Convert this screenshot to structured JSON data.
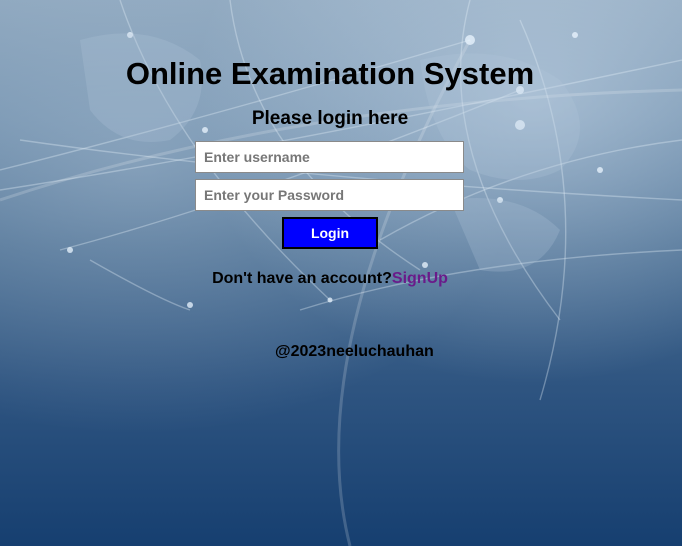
{
  "page": {
    "title": "Online Examination System",
    "subtitle": "Please login here"
  },
  "form": {
    "username_placeholder": "Enter username",
    "password_placeholder": "Enter your Password",
    "login_label": "Login"
  },
  "signup": {
    "prompt": "Don't have an account?",
    "link_label": "SignUp"
  },
  "footer": {
    "text": "@2023neeluchauhan"
  },
  "colors": {
    "login_button": "#0000ff",
    "signup_link": "#6a1b8a",
    "background_top": "#8aa4bc",
    "background_bottom": "#163f70"
  }
}
